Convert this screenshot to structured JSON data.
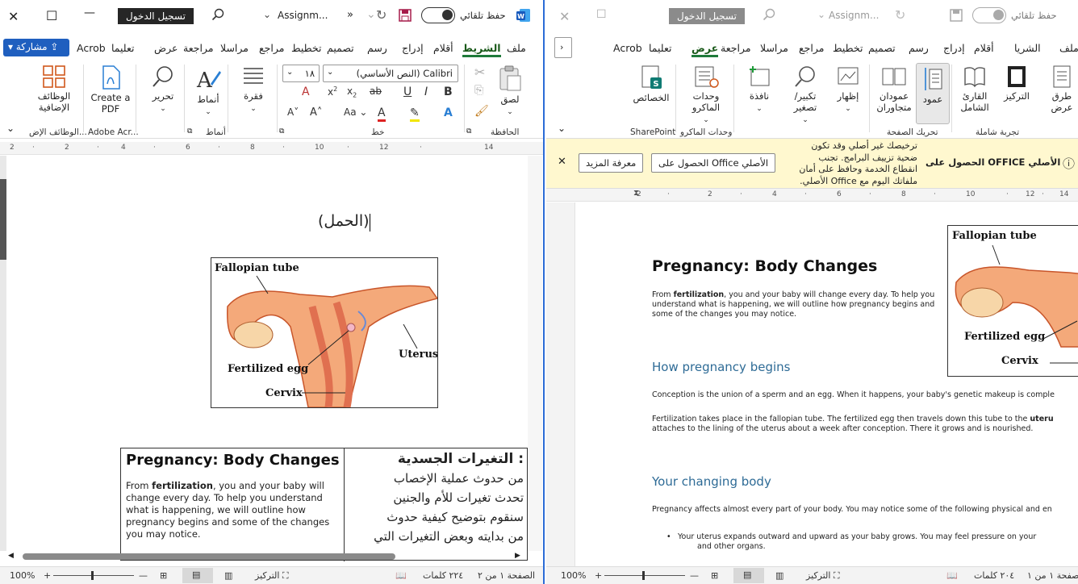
{
  "left": {
    "title": {
      "close": "✕",
      "restore": "☐",
      "minimize": "—",
      "signin": "تسجيل الدخول",
      "filename": "Assignm...",
      "autosave": "حفظ تلقائي",
      "more": "»"
    },
    "tabs": [
      "ملف",
      "الشريط",
      "أقلام",
      "إدراج",
      "رسم",
      "تصميم",
      "تخطيط",
      "مراجع",
      "مراسلا",
      "مراجعة",
      "عرض",
      "تعليما",
      "Acrob"
    ],
    "share": "مشاركة",
    "ribbon": {
      "paste": "لصق",
      "clipboard": "الحافظة",
      "font_name": "(النص الأساسي) Calibri",
      "font_size": "١٨",
      "font_group": "خط",
      "paragraph": "فقرة",
      "styles": "أنماط",
      "styles_group": "أنماط",
      "editing": "تحرير",
      "create_pdf": "Create a PDF",
      "acrobat_group": "Adobe Acr...",
      "addins": "الوظائف الإضافية",
      "addins_group": "الوظائف الإض..."
    },
    "ruler": [
      "2",
      "·",
      "2",
      "·",
      "4",
      "·",
      "6",
      "·",
      "8",
      "·",
      "10",
      "·",
      "12",
      "·",
      "14"
    ],
    "doc": {
      "heading": "(الحمل)",
      "figure": {
        "fallopian": "Fallopian tube",
        "egg": "Fertilized egg",
        "uterus": "Uterus",
        "cervix": "Cervix"
      },
      "table_en_title": "Pregnancy: Body Changes",
      "table_en_body_1": "From ",
      "table_en_bold": "fertilization",
      "table_en_body_2": ", you and your baby will change every day. To help you understand what is happening, we will outline how pregnancy begins and some of the changes you may notice.",
      "table_ar_title": ": التغيرات الجسدية",
      "table_ar_lines": [
        "من حدوث عملية الإخصاب",
        "تحدث تغيرات للأم والجنين",
        "سنقوم بتوضيح كيفية حدوث",
        "من بدايته وبعض التغيرات التي"
      ]
    },
    "status": {
      "page": "الصفحة ١ من ٢",
      "words": "٢٢٤ كلمات",
      "focus": "التركيز",
      "zoom": "100%"
    }
  },
  "right": {
    "title": {
      "close": "✕",
      "restore": "☐",
      "signin": "تسجيل الدخول",
      "filename": "Assignm...",
      "autosave": "حفظ تلقائي"
    },
    "tabs": [
      "ملف",
      "الشريا",
      "أقلام",
      "إدراج",
      "رسم",
      "تصميم",
      "تخطيط",
      "مراجع",
      "مراسلا",
      "مراجعة",
      "عرض",
      "تعليما",
      "Acrob"
    ],
    "ribbon": {
      "read": "طرق عرض",
      "focus": "التركيز",
      "reader": "القارئ الشامل",
      "immersive_group": "تجربة شاملة",
      "column": "عمود",
      "side_by_side": "عمودان متجاوران",
      "page_move_group": "تحريك الصفحة",
      "show": "إظهار",
      "zoom": "تكبير/ تصغير",
      "window": "نافذة",
      "macros": "وحدات الماكرو",
      "macros_group": "وحدات الماكرو",
      "properties": "الخصائص",
      "sharepoint": "SharePoint"
    },
    "banner": {
      "title": "الحصول على OFFICE الأصلي",
      "text_1": "ترخيصك غير أصلي وقد تكون",
      "text_2": "ضحية تزييف البرامج. تجنب",
      "text_3": "انقطاع الخدمة وحافظ على أمان",
      "text_4": "ملفاتك اليوم مع Office الأصلي.",
      "get_btn": "الحصول على Office الأصلي",
      "learn_btn": "معرفة المزيد",
      "close": "✕"
    },
    "ruler": [
      "14",
      "·",
      "12",
      "·",
      "10",
      "·",
      "8",
      "·",
      "6",
      "·",
      "4",
      "·",
      "2",
      "·",
      "2"
    ],
    "doc": {
      "title": "Pregnancy: Body Changes",
      "intro_1": "From ",
      "intro_bold": "fertilization",
      "intro_2": ", you and your baby will change every day. To help you understand what is happening, we will outline how pregnancy begins and some of the changes you may notice.",
      "h_begins": "How pregnancy begins",
      "p_conception": "Conception is the union of a sperm and an egg. When it happens, your baby's genetic makeup is comple",
      "p_fert_1": "Fertilization takes place in the fallopian tube. The fertilized egg then travels down this tube to the ",
      "p_fert_bold": "uteru",
      "p_fert_2": "attaches to the lining of the uterus about a week after conception. There it grows and is nourished.",
      "h_changing": "Your changing body",
      "p_affects": "Pregnancy affects almost every part of your body. You may notice some of the following physical and en",
      "bullet_1": "Your uterus expands outward and upward as your baby grows. You may feel pressure on your",
      "bullet_2": "and other organs.",
      "figure": {
        "fallopian": "Fallopian tube",
        "egg": "Fertilized egg",
        "cervix": "Cervix"
      }
    },
    "status": {
      "page": "الصفحة ١ من ١",
      "words": "٢٠٤ كلمات",
      "focus": "التركيز",
      "zoom": "100%"
    }
  },
  "colors": {
    "accent": "#2b6cd6",
    "tab_active": "#1f7a3a",
    "banner": "#fff8cf",
    "heading_blue": "#2e6b96"
  }
}
